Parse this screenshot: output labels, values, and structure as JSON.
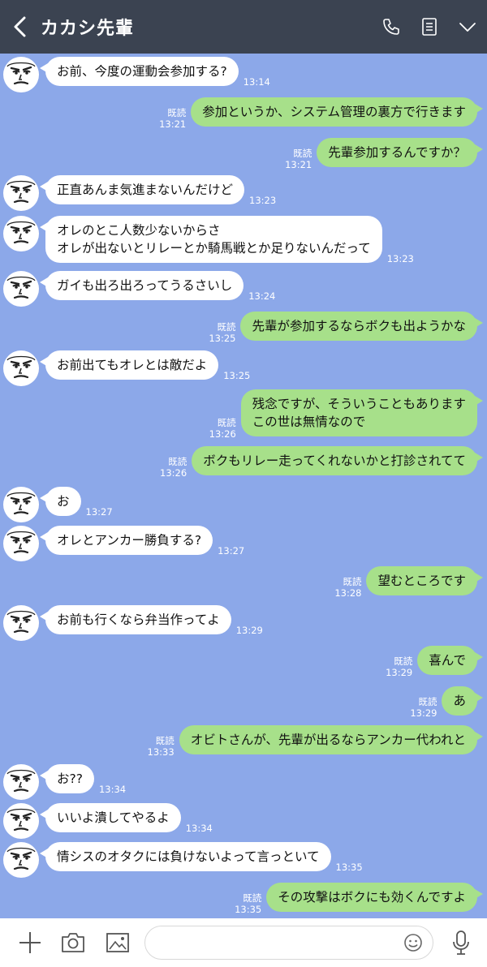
{
  "header": {
    "title": "カカシ先輩"
  },
  "read_label": "既読",
  "messages": [
    {
      "side": "left",
      "lines": [
        "お前、今度の運動会参加する?"
      ],
      "time": "13:14"
    },
    {
      "side": "right",
      "lines": [
        "参加というか、システム管理の裏方で行きます"
      ],
      "time": "13:21",
      "read": true
    },
    {
      "side": "right",
      "lines": [
        "先輩参加するんですか？"
      ],
      "time": "13:21",
      "read": true
    },
    {
      "side": "left",
      "lines": [
        "正直あんま気進まないんだけど"
      ],
      "time": "13:23"
    },
    {
      "side": "left",
      "lines": [
        "オレのとこ人数少ないからさ",
        "オレが出ないとリレーとか騎馬戦とか足りないんだって"
      ],
      "time": "13:23"
    },
    {
      "side": "left",
      "lines": [
        "ガイも出ろ出ろってうるさいし"
      ],
      "time": "13:24"
    },
    {
      "side": "right",
      "lines": [
        "先輩が参加するならボクも出ようかな"
      ],
      "time": "13:25",
      "read": true
    },
    {
      "side": "left",
      "lines": [
        "お前出てもオレとは敵だよ"
      ],
      "time": "13:25"
    },
    {
      "side": "right",
      "lines": [
        "残念ですが、そういうこともあります",
        "この世は無情なので"
      ],
      "time": "13:26",
      "read": true
    },
    {
      "side": "right",
      "lines": [
        "ボクもリレー走ってくれないかと打診されてて"
      ],
      "time": "13:26",
      "read": true
    },
    {
      "side": "left",
      "lines": [
        "お"
      ],
      "time": "13:27"
    },
    {
      "side": "left",
      "lines": [
        "オレとアンカー勝負する?"
      ],
      "time": "13:27"
    },
    {
      "side": "right",
      "lines": [
        "望むところです"
      ],
      "time": "13:28",
      "read": true
    },
    {
      "side": "left",
      "lines": [
        "お前も行くなら弁当作ってよ"
      ],
      "time": "13:29"
    },
    {
      "side": "right",
      "lines": [
        "喜んで"
      ],
      "time": "13:29",
      "read": true
    },
    {
      "side": "right",
      "lines": [
        "あ"
      ],
      "time": "13:29",
      "read": true
    },
    {
      "side": "right",
      "lines": [
        "オビトさんが、先輩が出るならアンカー代われと"
      ],
      "time": "13:33",
      "read": true
    },
    {
      "side": "left",
      "lines": [
        "お??"
      ],
      "time": "13:34"
    },
    {
      "side": "left",
      "lines": [
        "いいよ潰してやるよ"
      ],
      "time": "13:34"
    },
    {
      "side": "left",
      "lines": [
        "情シスのオタクには負けないよって言っといて"
      ],
      "time": "13:35"
    },
    {
      "side": "right",
      "lines": [
        "その攻撃はボクにも効くんですよ"
      ],
      "time": "13:35",
      "read": true
    }
  ],
  "input": {
    "placeholder": "",
    "value": ""
  },
  "icons": {
    "back": "chevron-left-icon",
    "call": "phone-icon",
    "notes": "notes-icon",
    "menu": "chevron-down-icon",
    "add": "plus-icon",
    "camera": "camera-icon",
    "image": "image-icon",
    "emoji": "emoji-icon",
    "mic": "microphone-icon"
  },
  "colors": {
    "header": "#3b4351",
    "background": "#8ca8e9",
    "sent_bubble": "#a7e08a",
    "received_bubble": "#ffffff"
  }
}
